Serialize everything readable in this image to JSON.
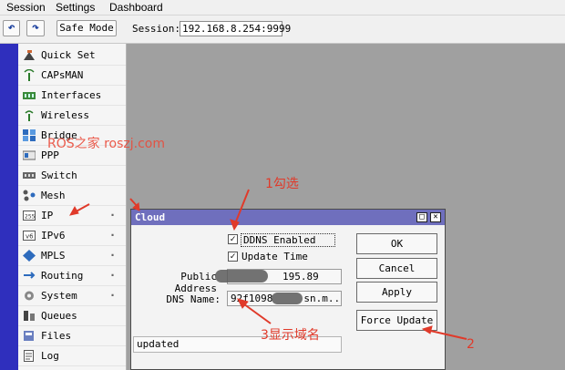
{
  "menubar": {
    "items": [
      "Session",
      "Settings",
      "Dashboard"
    ]
  },
  "toolbar": {
    "undo_icon": "undo-icon",
    "redo_icon": "redo-icon",
    "safe_mode_label": "Safe Mode",
    "session_label": "Session:",
    "session_value": "192.168.8.254:9999"
  },
  "sidebar": {
    "items": [
      {
        "label": "Quick Set",
        "icon": "quick-set-icon",
        "submenu": false
      },
      {
        "label": "CAPsMAN",
        "icon": "antenna-icon",
        "submenu": false
      },
      {
        "label": "Interfaces",
        "icon": "interfaces-icon",
        "submenu": false
      },
      {
        "label": "Wireless",
        "icon": "wireless-icon",
        "submenu": false
      },
      {
        "label": "Bridge",
        "icon": "bridge-icon",
        "submenu": false
      },
      {
        "label": "PPP",
        "icon": "ppp-icon",
        "submenu": false
      },
      {
        "label": "Switch",
        "icon": "switch-icon",
        "submenu": false
      },
      {
        "label": "Mesh",
        "icon": "mesh-icon",
        "submenu": false
      },
      {
        "label": "IP",
        "icon": "ip-icon",
        "submenu": true
      },
      {
        "label": "IPv6",
        "icon": "ipv6-icon",
        "submenu": true
      },
      {
        "label": "MPLS",
        "icon": "mpls-icon",
        "submenu": true
      },
      {
        "label": "Routing",
        "icon": "routing-icon",
        "submenu": true
      },
      {
        "label": "System",
        "icon": "gear-icon",
        "submenu": true
      },
      {
        "label": "Queues",
        "icon": "queues-icon",
        "submenu": false
      },
      {
        "label": "Files",
        "icon": "files-icon",
        "submenu": false
      },
      {
        "label": "Log",
        "icon": "log-icon",
        "submenu": false
      }
    ]
  },
  "dialog": {
    "title": "Cloud",
    "ddns_enabled_label": "DDNS Enabled",
    "ddns_enabled": true,
    "update_time_label": "Update Time",
    "update_time": true,
    "public_address_label": "Public Address",
    "public_address_value": "195.89",
    "dns_name_label": "DNS Name:",
    "dns_name_value_prefix": "92f1098",
    "dns_name_value_suffix": "sn.m...",
    "ok_label": "OK",
    "cancel_label": "Cancel",
    "apply_label": "Apply",
    "force_update_label": "Force Update",
    "status_text": "updated"
  },
  "annotations": {
    "step1": "1勾选",
    "step2": "2",
    "step3": "3显示域名",
    "watermark": "ROS之家 roszj.com"
  },
  "colors": {
    "dialog_title_bar": "#6f6fbd",
    "left_bar": "#2f2fbd",
    "annotation": "#e03a2a",
    "workspace": "#a0a0a0"
  }
}
